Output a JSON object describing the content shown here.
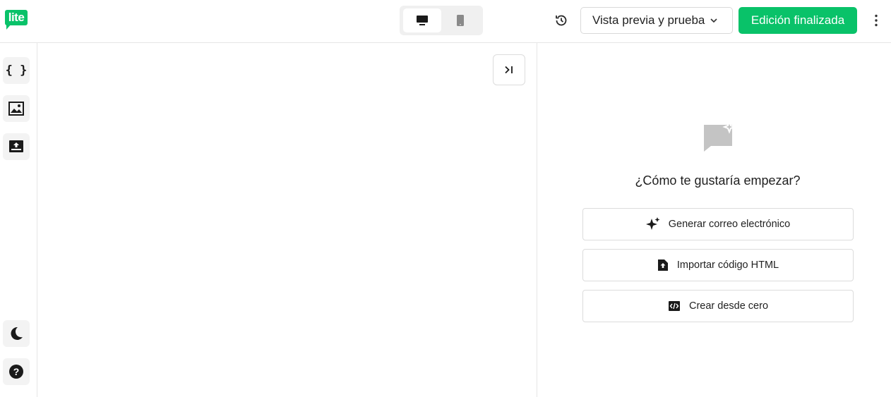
{
  "brand": {
    "logo_text": "lite",
    "accent_color": "#09c269"
  },
  "header": {
    "device_toggle": {
      "options": [
        "desktop",
        "mobile"
      ],
      "selected": "desktop"
    },
    "history_icon": "history-icon",
    "preview_label": "Vista previa y prueba",
    "done_label": "Edición finalizada",
    "more_icon": "more-vertical-icon"
  },
  "sidebar": {
    "top_items": [
      {
        "icon": "code-braces-icon",
        "glyph": "{ }"
      },
      {
        "icon": "image-icon"
      },
      {
        "icon": "upload-icon"
      }
    ],
    "bottom_items": [
      {
        "icon": "moon-icon"
      },
      {
        "icon": "help-icon",
        "glyph": "?"
      }
    ]
  },
  "panel": {
    "heading": "¿Cómo te gustaría empezar?",
    "options": [
      {
        "label": "Generar correo electrónico",
        "icon": "sparkle-icon"
      },
      {
        "label": "Importar código HTML",
        "icon": "file-upload-icon"
      },
      {
        "label": "Crear desde cero",
        "icon": "code-file-icon"
      }
    ]
  }
}
